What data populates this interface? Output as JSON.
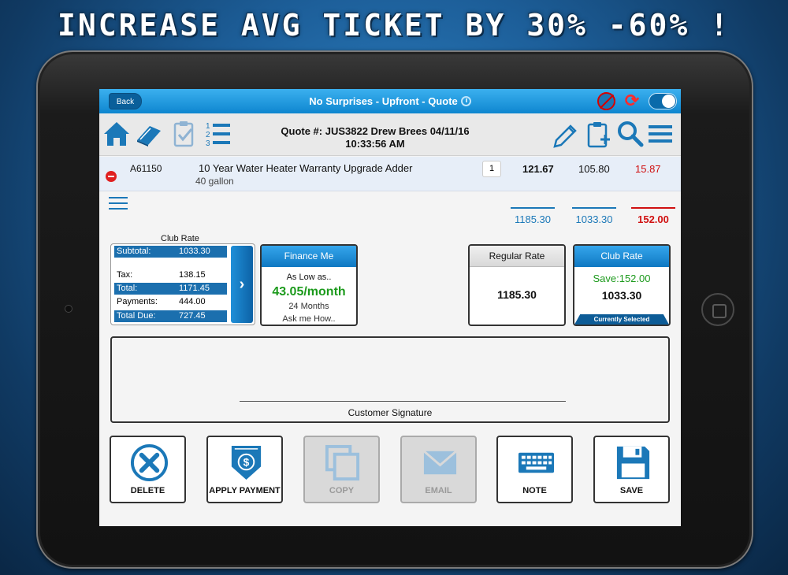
{
  "headline": "INCREASE AVG TICKET BY 30% -60% !",
  "titlebar": {
    "back_label": "Back",
    "title": "No Surprises - Upfront - Quote"
  },
  "quote_header": {
    "line1": "Quote #: JUS3822   Drew Brees  04/11/16",
    "line2": "10:33:56 AM"
  },
  "line_item": {
    "sku": "A61150",
    "description": "10 Year Water Heater Warranty Upgrade Adder",
    "sub": "40 gallon",
    "qty": "1",
    "price_regular": "121.67",
    "price_club": "105.80",
    "savings": "15.87"
  },
  "totals": {
    "regular": "1185.30",
    "club": "1033.30",
    "savings": "152.00"
  },
  "club_summary": {
    "label": "Club Rate",
    "rows": [
      {
        "label": "Subtotal:",
        "value": "1033.30"
      },
      {
        "label": "Tax:",
        "value": "138.15"
      },
      {
        "label": "Total:",
        "value": "1171.45"
      },
      {
        "label": "Payments:",
        "value": "444.00"
      },
      {
        "label": "Total Due:",
        "value": "727.45"
      }
    ],
    "arrow": "›"
  },
  "finance": {
    "header": "Finance Me",
    "line1": "As Low as..",
    "monthly": "43.05/month",
    "term": "24 Months",
    "cta": "Ask me How.."
  },
  "regular_rate": {
    "header": "Regular Rate",
    "price": "1185.30"
  },
  "club_rate": {
    "header": "Club Rate",
    "save": "Save:152.00",
    "price": "1033.30",
    "selected": "Currently Selected"
  },
  "signature": {
    "label": "Customer Signature"
  },
  "actions": [
    {
      "label": "DELETE",
      "icon": "delete-icon"
    },
    {
      "label": "APPLY PAYMENT",
      "icon": "payment-shield-icon"
    },
    {
      "label": "COPY",
      "icon": "copy-icon"
    },
    {
      "label": "EMAIL",
      "icon": "email-icon"
    },
    {
      "label": "NOTE",
      "icon": "keyboard-icon"
    },
    {
      "label": "SAVE",
      "icon": "floppy-disk-icon"
    }
  ],
  "colors": {
    "accent_blue": "#1b78b8",
    "titlebar_blue": "#0e86cf",
    "savings_red": "#d01010",
    "finance_green": "#1c9a1c"
  }
}
